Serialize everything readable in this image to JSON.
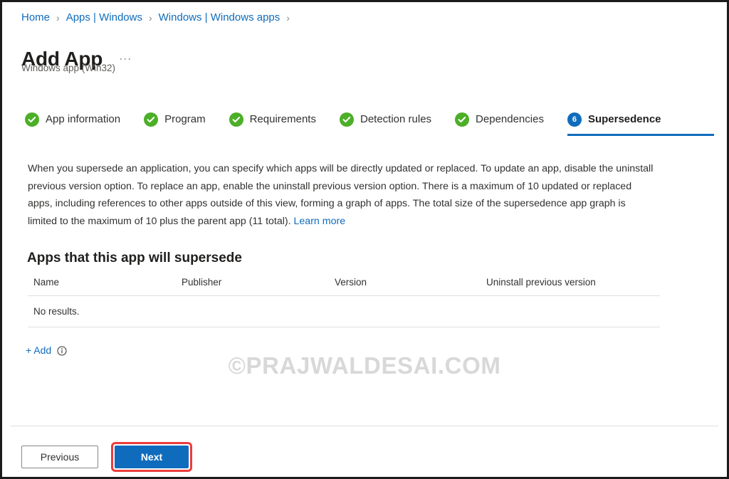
{
  "breadcrumb": {
    "separator": "›",
    "items": [
      {
        "label": "Home"
      },
      {
        "label": "Apps | Windows"
      },
      {
        "label": "Windows | Windows apps"
      }
    ]
  },
  "header": {
    "title": "Add App",
    "ellipsis": "…",
    "subtitle": "Windows app (Win32)"
  },
  "wizard": {
    "tabs": [
      {
        "label": "App information",
        "state": "done",
        "badge": ""
      },
      {
        "label": "Program",
        "state": "done",
        "badge": ""
      },
      {
        "label": "Requirements",
        "state": "done",
        "badge": ""
      },
      {
        "label": "Detection rules",
        "state": "done",
        "badge": ""
      },
      {
        "label": "Dependencies",
        "state": "done",
        "badge": ""
      },
      {
        "label": "Supersedence",
        "state": "active",
        "badge": "6"
      }
    ]
  },
  "main": {
    "description": "When you supersede an application, you can specify which apps will be directly updated or replaced. To update an app, disable the uninstall previous version option. To replace an app, enable the uninstall previous version option. There is a maximum of 10 updated or replaced apps, including references to other apps outside of this view, forming a graph of apps. The total size of the supersedence app graph is limited to the maximum of 10 plus the parent app (11 total). ",
    "learn_more": "Learn more",
    "section_heading": "Apps that this app will supersede",
    "table": {
      "columns": [
        "Name",
        "Publisher",
        "Version",
        "Uninstall previous version"
      ],
      "rows": [],
      "empty_text": "No results."
    },
    "add_label": "+ Add",
    "add_info_tooltip": "info-icon"
  },
  "watermark": "©PRAJWALDESAI.COM",
  "footer": {
    "previous_label": "Previous",
    "next_label": "Next"
  },
  "colors": {
    "link": "#0f6cbd",
    "accent": "#0f6cbd",
    "success": "#4caf28",
    "highlight": "#ee3b3b",
    "divider": "#e1dfdd",
    "watermark": "#d8d8d8"
  }
}
